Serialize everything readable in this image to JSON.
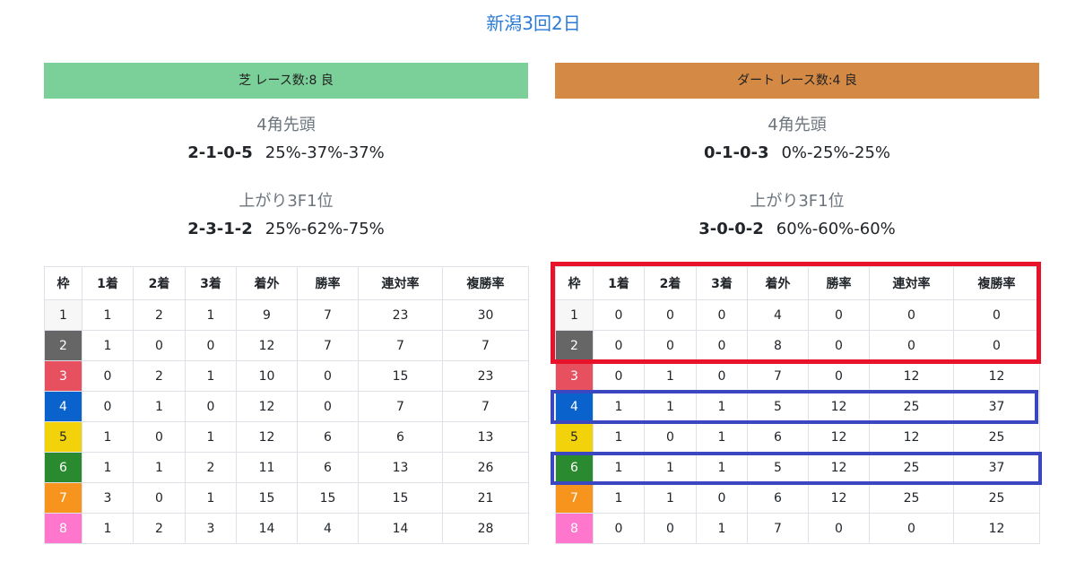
{
  "title": "新潟3回2日",
  "columns": [
    "枠",
    "1着",
    "2着",
    "3着",
    "着外",
    "勝率",
    "連対率",
    "複勝率"
  ],
  "waku_colors": [
    "#f7f7f7",
    "#666666",
    "#e6505f",
    "#0a63cc",
    "#f2d20a",
    "#2a8a2f",
    "#f7941d",
    "#ff77cc"
  ],
  "waku_text_colors": [
    "#212529",
    "#ffffff",
    "#ffffff",
    "#ffffff",
    "#212529",
    "#ffffff",
    "#ffffff",
    "#ffffff"
  ],
  "turf": {
    "header": "芝 レース数:8 良",
    "header_color": "#7bcf98",
    "lead": {
      "label": "4角先頭",
      "record": "2-1-0-5",
      "rates": "25%-37%-37%"
    },
    "last3f": {
      "label": "上がり3F1位",
      "record": "2-3-1-2",
      "rates": "25%-62%-75%"
    },
    "rows": [
      [
        "1",
        "1",
        "2",
        "1",
        "9",
        "7",
        "23",
        "30"
      ],
      [
        "2",
        "1",
        "0",
        "0",
        "12",
        "7",
        "7",
        "7"
      ],
      [
        "3",
        "0",
        "2",
        "1",
        "10",
        "0",
        "15",
        "23"
      ],
      [
        "4",
        "0",
        "1",
        "0",
        "12",
        "0",
        "7",
        "7"
      ],
      [
        "5",
        "1",
        "0",
        "1",
        "12",
        "6",
        "6",
        "13"
      ],
      [
        "6",
        "1",
        "1",
        "2",
        "11",
        "6",
        "13",
        "26"
      ],
      [
        "7",
        "3",
        "0",
        "1",
        "15",
        "15",
        "15",
        "21"
      ],
      [
        "8",
        "1",
        "2",
        "3",
        "14",
        "4",
        "14",
        "28"
      ]
    ]
  },
  "dirt": {
    "header": "ダート レース数:4 良",
    "header_color": "#d48a45",
    "lead": {
      "label": "4角先頭",
      "record": "0-1-0-3",
      "rates": "0%-25%-25%"
    },
    "last3f": {
      "label": "上がり3F1位",
      "record": "3-0-0-2",
      "rates": "60%-60%-60%"
    },
    "rows": [
      [
        "1",
        "0",
        "0",
        "0",
        "4",
        "0",
        "0",
        "0"
      ],
      [
        "2",
        "0",
        "0",
        "0",
        "8",
        "0",
        "0",
        "0"
      ],
      [
        "3",
        "0",
        "1",
        "0",
        "7",
        "0",
        "12",
        "12"
      ],
      [
        "4",
        "1",
        "1",
        "1",
        "5",
        "12",
        "25",
        "37"
      ],
      [
        "5",
        "1",
        "0",
        "1",
        "6",
        "12",
        "12",
        "25"
      ],
      [
        "6",
        "1",
        "1",
        "1",
        "5",
        "12",
        "25",
        "37"
      ],
      [
        "7",
        "1",
        "1",
        "0",
        "6",
        "12",
        "25",
        "25"
      ],
      [
        "8",
        "0",
        "0",
        "1",
        "7",
        "0",
        "0",
        "12"
      ]
    ]
  },
  "highlight_colors": {
    "red": "#e8132b",
    "blue": "#3a47c0"
  }
}
